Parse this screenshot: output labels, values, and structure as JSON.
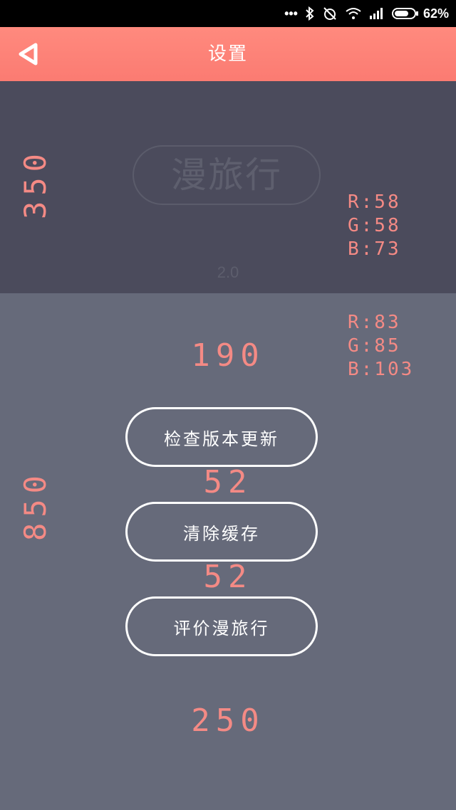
{
  "status_bar": {
    "battery": "62%"
  },
  "nav": {
    "title": "设置"
  },
  "logo": {
    "text": "漫旅行",
    "version": "2.0"
  },
  "annotations": {
    "top_height": "350",
    "top_rgb": [
      "R:58",
      "G:58",
      "B:73"
    ],
    "main_height": "850",
    "main_rgb": [
      "R:83",
      "G:85",
      "B:103"
    ],
    "gap_top": "190",
    "gap_between_1": "52",
    "gap_between_2": "52",
    "gap_bottom": "250"
  },
  "buttons": {
    "check_update": "检查版本更新",
    "clear_cache": "清除缓存",
    "rate_app": "评价漫旅行"
  },
  "colors": {
    "nav_bar": "#fb7b72",
    "top_panel": "#4b4b5c",
    "main_panel": "#666a7a",
    "annotation": "#f48a85"
  }
}
